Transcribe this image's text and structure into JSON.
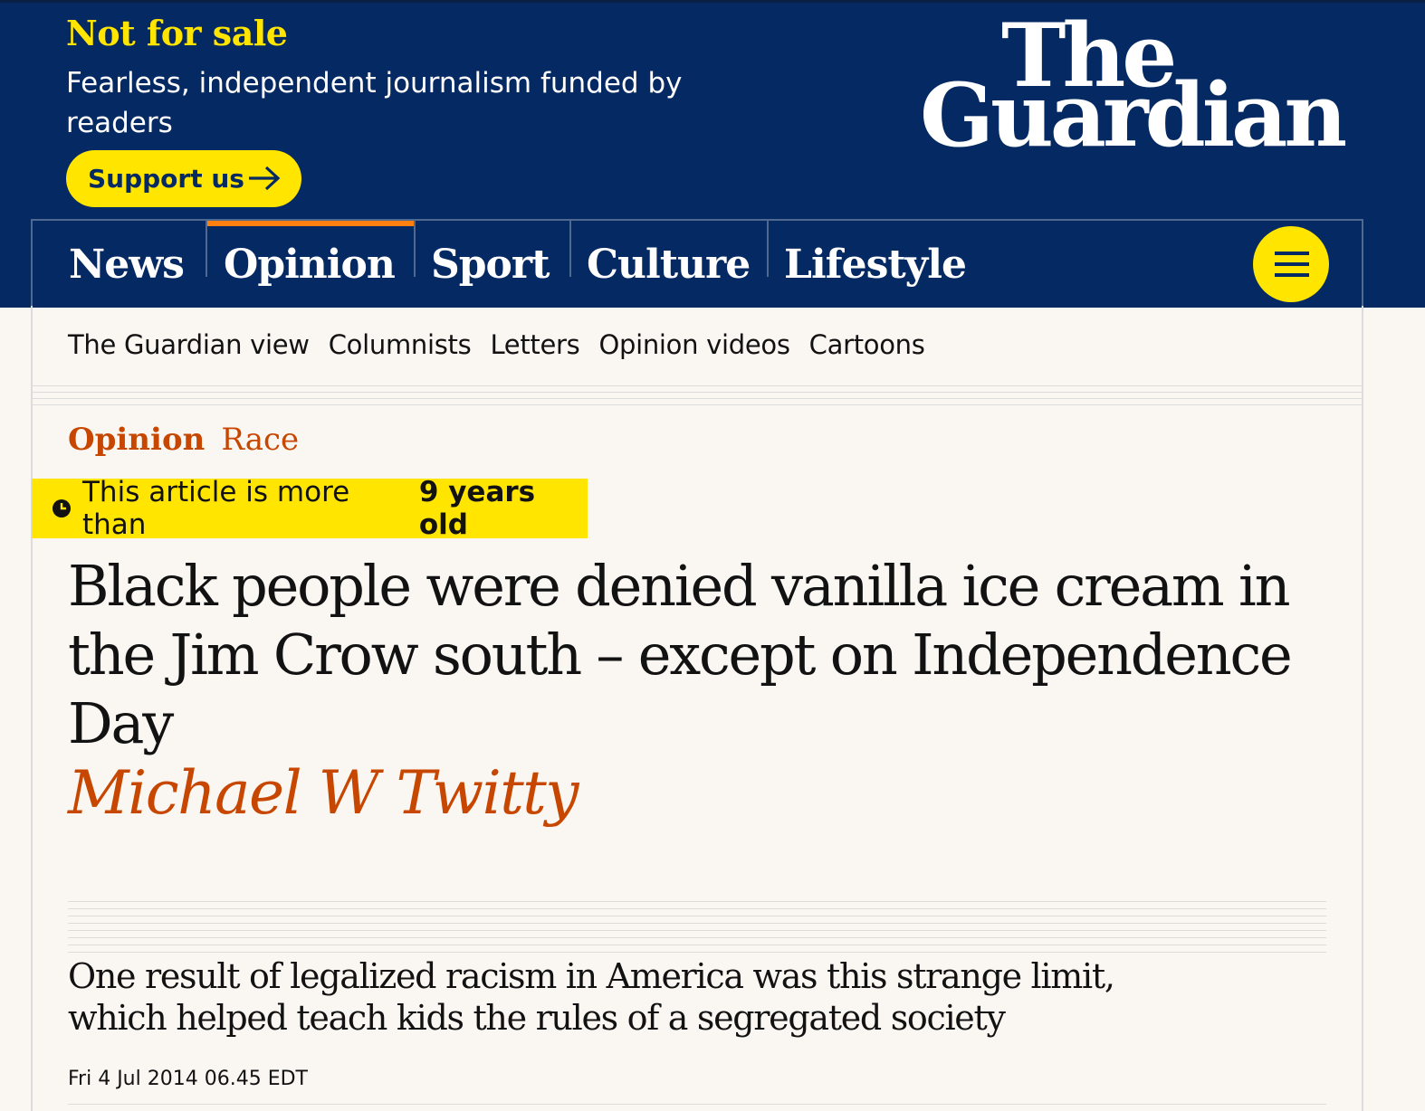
{
  "header": {
    "title": "Not for sale",
    "tagline": "Fearless, independent journalism funded by readers",
    "support_label": "Support us",
    "logo_line1": "The",
    "logo_line2": "Guardian"
  },
  "nav": {
    "items": [
      "News",
      "Opinion",
      "Sport",
      "Culture",
      "Lifestyle"
    ],
    "active": "Opinion",
    "menu_icon": "hamburger-icon"
  },
  "subnav": {
    "items": [
      "The Guardian view",
      "Columnists",
      "Letters",
      "Opinion videos",
      "Cartoons"
    ]
  },
  "article": {
    "section": "Opinion",
    "tag": "Race",
    "age_prefix": "This article is more than",
    "age_value": "9 years old",
    "headline": "Black people were denied vanilla ice cream in the Jim Crow south – except on Independence Day",
    "byline": "Michael W Twitty",
    "standfirst": "One result of legalized racism in America was this strange limit, which helped teach kids the rules of a segregated society",
    "date": "Fri 4 Jul 2014 06.45 EDT"
  },
  "colors": {
    "brand": "#052962",
    "highlight": "#ffe500",
    "opinion": "#c74600",
    "active_tab": "#ff7f0f"
  }
}
